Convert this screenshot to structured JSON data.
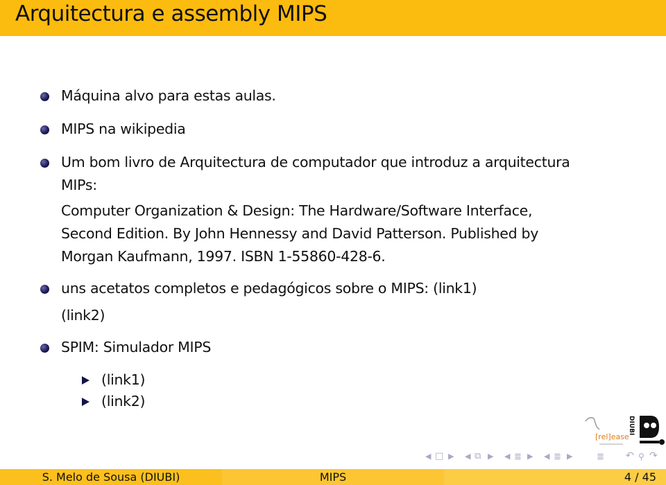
{
  "header": {
    "title": "Arquitectura e assembly MIPS"
  },
  "colors": {
    "header_bg": "#fcbb0f",
    "bullet": "#1c1c5a",
    "footer_left": "#fbbf1e",
    "footer_mid": "#fcc533",
    "footer_right": "#fccc45"
  },
  "items": [
    {
      "text": "Máquina alvo para estas aulas."
    },
    {
      "text": "MIPS na wikipedia"
    },
    {
      "line1": "Um bom livro de Arquitectura de computador que introduz a arquitectura",
      "line2": "MIPs:"
    },
    {
      "book_line1": "Computer Organization & Design: The Hardware/Software Interface,",
      "book_line2": "Second Edition. By John Hennessy and David Patterson. Published by",
      "book_line3": "Morgan Kaufmann, 1997. ISBN 1-55860-428-6."
    },
    {
      "text": "uns acetatos completos e pedagógicos sobre o MIPS:",
      "link1": "(link1)",
      "link2": "(link2)"
    },
    {
      "text": "SPIM: Simulador MIPS",
      "subitems": [
        "(link1)",
        "(link2)"
      ]
    }
  ],
  "logos": {
    "release": "[rel]ease",
    "diubi": "DIUBI"
  },
  "nav_icons": [
    "nav-left",
    "frame-icon",
    "nav-right",
    "nav-left",
    "subsection-icon",
    "nav-right",
    "nav-left",
    "section-icon",
    "nav-right",
    "nav-left",
    "section-list-icon",
    "nav-right",
    "outline-icon",
    "undo-icon",
    "search-icon",
    "redo-icon"
  ],
  "footer": {
    "author": "S. Melo de Sousa  (DIUBI)",
    "short_title": "MIPS",
    "page": "4 / 45"
  }
}
